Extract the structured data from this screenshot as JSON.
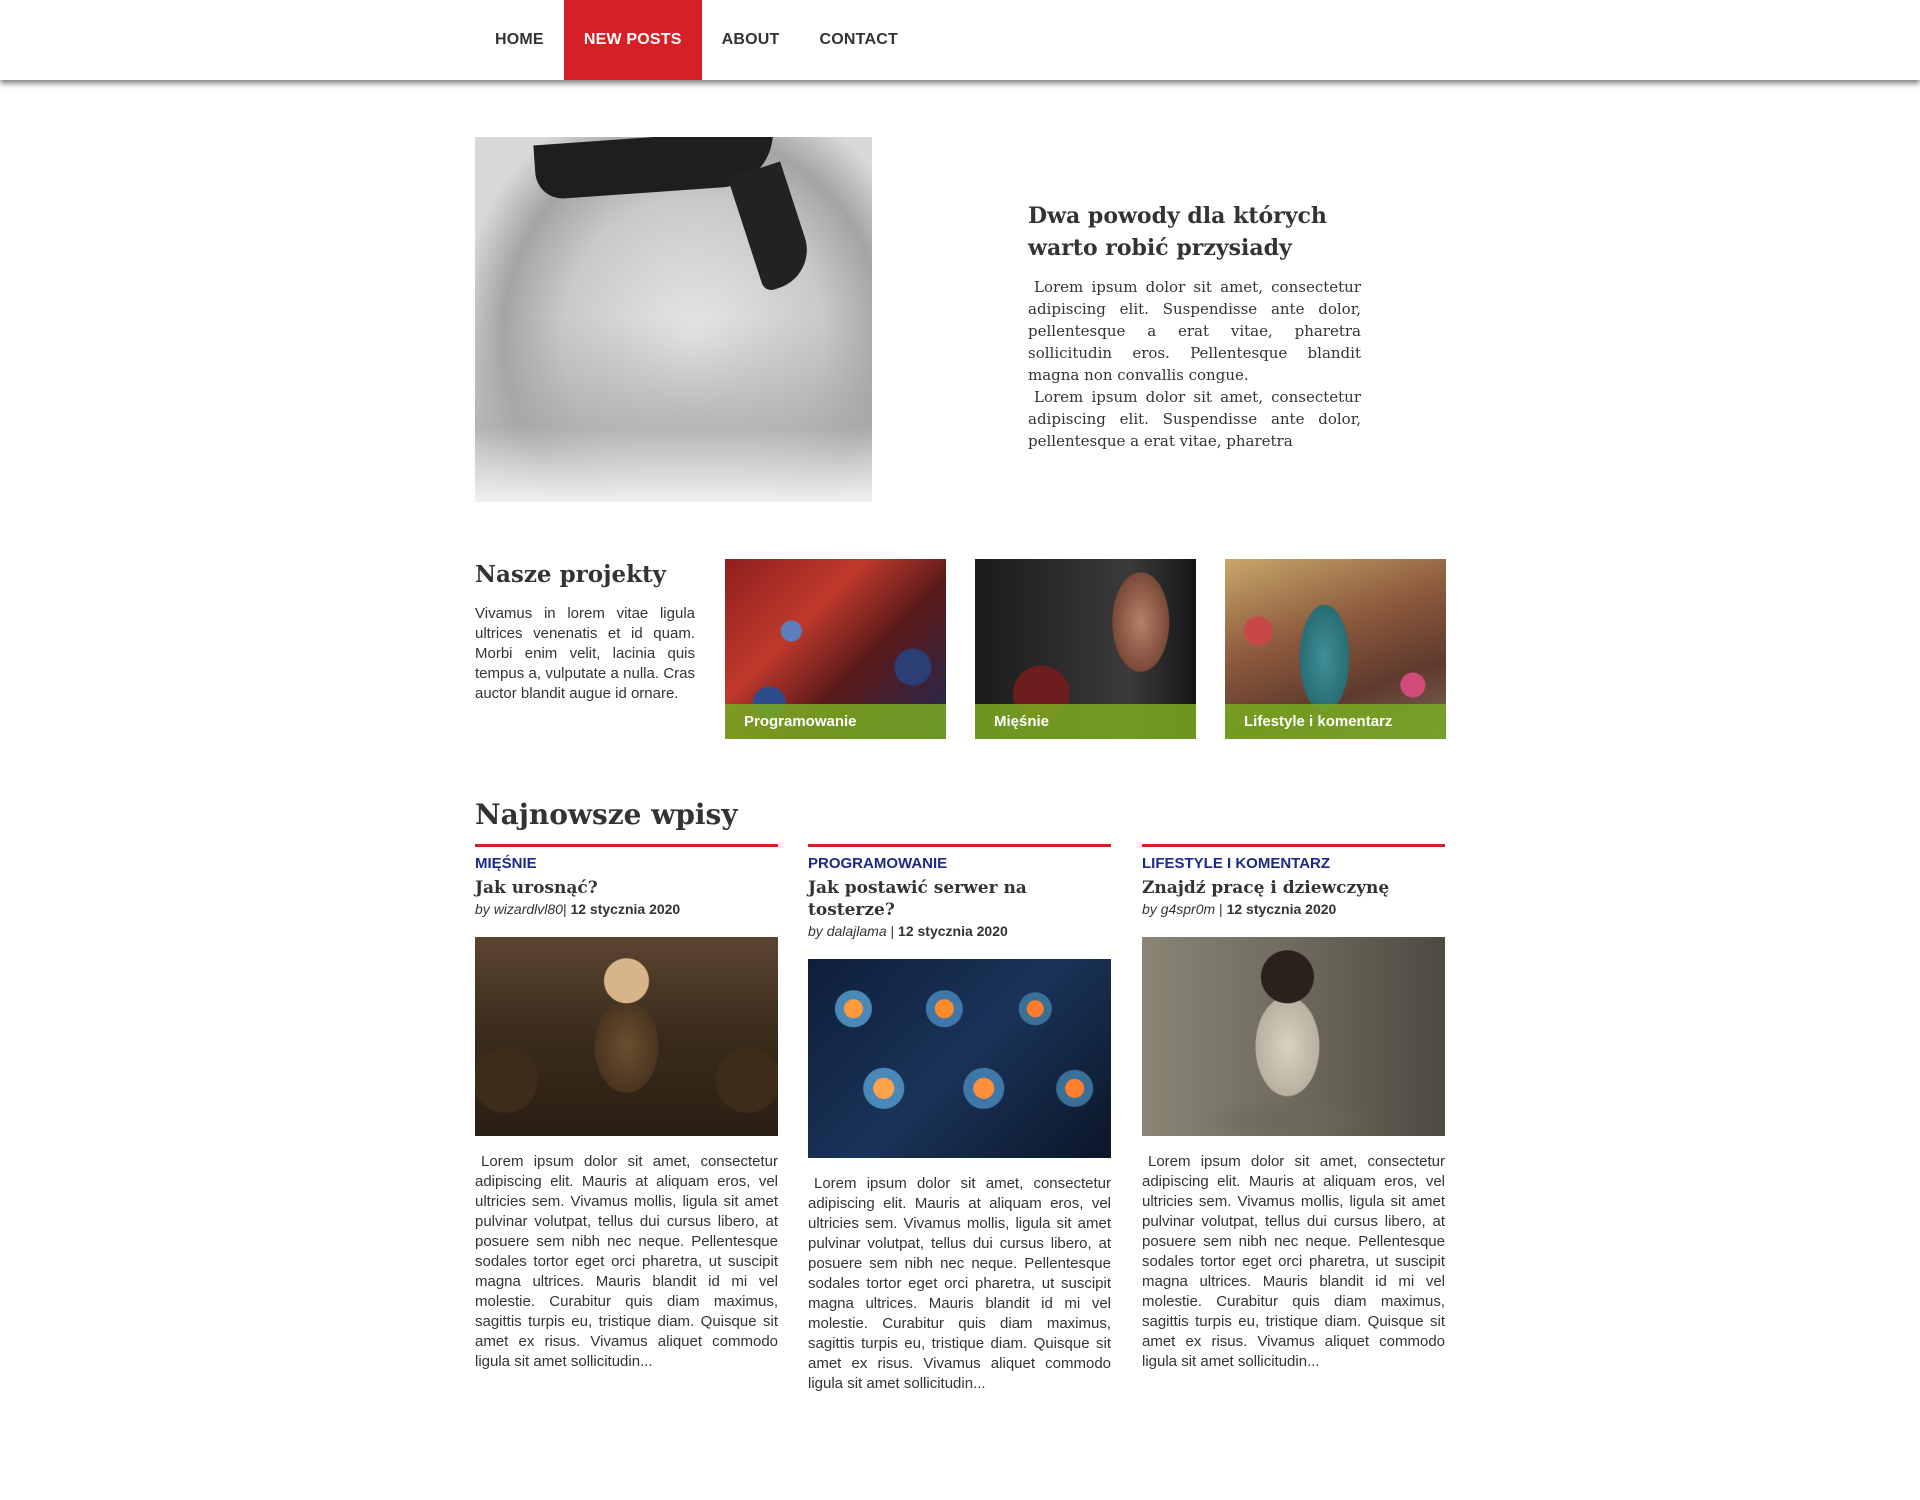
{
  "nav": {
    "items": [
      {
        "label": "HOME",
        "active": false
      },
      {
        "label": "NEW POSTS",
        "active": true
      },
      {
        "label": "ABOUT",
        "active": false
      },
      {
        "label": "CONTACT",
        "active": false
      }
    ]
  },
  "hero": {
    "title_line1": "Dwa powody dla których",
    "title_line2": "warto robić przysiady",
    "paragraph1": "Lorem ipsum dolor sit amet, consectetur adipiscing elit. Suspendisse ante dolor, pellentesque a erat vitae, pharetra sollicitudin eros. Pellentesque blandit magna non convallis congue.",
    "paragraph2": "Lorem ipsum dolor sit amet, consectetur adipiscing elit. Suspendisse ante dolor, pellentesque a erat vitae, pharetra"
  },
  "projects": {
    "title": "Nasze projekty",
    "description": "Vivamus in lorem vitae ligula ultrices venenatis et id quam. Morbi enim velit, lacinia quis tempus a, vulputate a nulla. Cras auctor blandit augue id ornare.",
    "tiles": [
      {
        "label": "Programowanie"
      },
      {
        "label": "Mięśnie"
      },
      {
        "label": "Lifestyle i komentarz"
      }
    ]
  },
  "posts": {
    "title": "Najnowsze wpisy",
    "items": [
      {
        "category": "MIĘŚNIE",
        "title": "Jak urosnąć?",
        "by": "by",
        "author": "wizardlvl80",
        "separator": "|",
        "date": "12 stycznia 2020",
        "excerpt": "Lorem ipsum dolor sit amet, consectetur adipiscing elit. Mauris at aliquam eros, vel ultricies sem. Vivamus mollis, ligula sit amet pulvinar volutpat, tellus dui cursus libero, at posuere sem nibh nec neque. Pellentesque sodales tortor eget orci pharetra, ut suscipit magna ultrices. Mauris blandit id mi vel molestie. Curabitur quis diam maximus, sagittis turpis eu, tristique diam. Quisque sit amet ex risus. Vivamus aliquet commodo ligula sit amet sollicitudin..."
      },
      {
        "category": "PROGRAMOWANIE",
        "title": "Jak postawić serwer na tosterze?",
        "by": "by",
        "author": "dalajlama",
        "separator": "|",
        "date": "12 stycznia 2020",
        "excerpt": "Lorem ipsum dolor sit amet, consectetur adipiscing elit. Mauris at aliquam eros, vel ultricies sem. Vivamus mollis, ligula sit amet pulvinar volutpat, tellus dui cursus libero, at posuere sem nibh nec neque. Pellentesque sodales tortor eget orci pharetra, ut suscipit magna ultrices. Mauris blandit id mi vel molestie. Curabitur quis diam maximus, sagittis turpis eu, tristique diam. Quisque sit amet ex risus. Vivamus aliquet commodo ligula sit amet sollicitudin..."
      },
      {
        "category": "LIFESTYLE I KOMENTARZ",
        "title": "Znajdź pracę i dziewczynę",
        "by": "by",
        "author": "g4spr0m",
        "separator": "|",
        "date": "12 stycznia 2020",
        "excerpt": "Lorem ipsum dolor sit amet, consectetur adipiscing elit. Mauris at aliquam eros, vel ultricies sem. Vivamus mollis, ligula sit amet pulvinar volutpat, tellus dui cursus libero, at posuere sem nibh nec neque. Pellentesque sodales tortor eget orci pharetra, ut suscipit magna ultrices. Mauris blandit id mi vel molestie. Curabitur quis diam maximus, sagittis turpis eu, tristique diam. Quisque sit amet ex risus. Vivamus aliquet commodo ligula sit amet sollicitudin..."
      }
    ]
  },
  "colors": {
    "accent": "#d71f26",
    "category": "#1b2a8a",
    "tile_caption": "#77a721"
  }
}
